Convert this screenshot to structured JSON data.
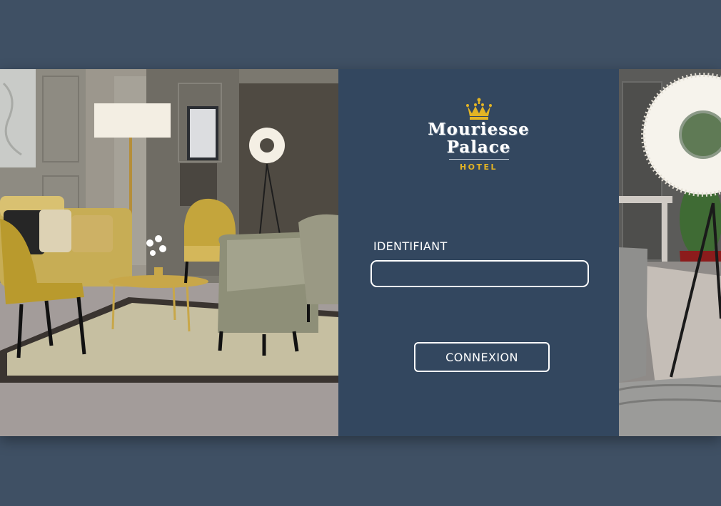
{
  "login_panel": {
    "logo": {
      "icon": "crown-icon",
      "name_line1": "Mouriesse",
      "name_line2": "Palace",
      "subtitle": "HOTEL"
    },
    "identifier_label": "IDENTIFIANT",
    "identifier_value": "",
    "submit_label": "CONNEXION"
  },
  "colors": {
    "page_background": "#3f5064",
    "panel_background": "#33475f",
    "accent_gold": "#e3b424",
    "text": "#ffffff"
  }
}
